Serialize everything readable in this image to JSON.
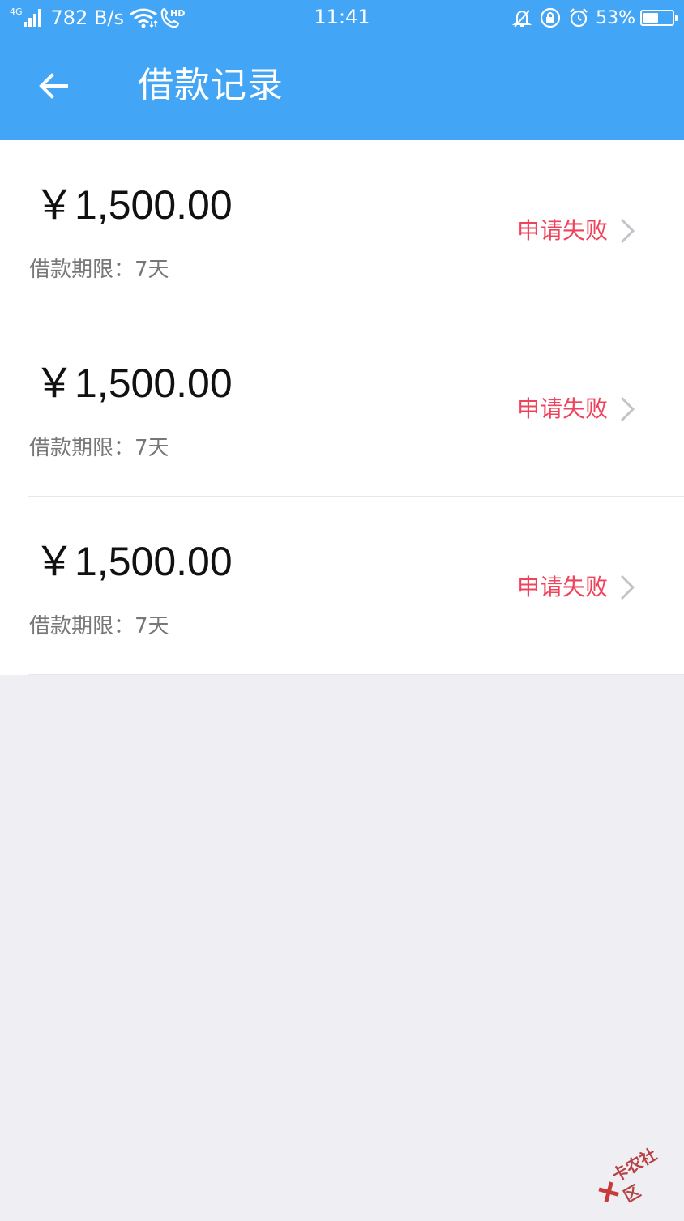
{
  "status_bar": {
    "network": "4G",
    "speed": "782 B/s",
    "hd": "HD",
    "time": "11:41",
    "battery": "53%",
    "battery_level": 0.53
  },
  "header": {
    "title": "借款记录"
  },
  "records": [
    {
      "amount": "￥1,500.00",
      "term": "借款期限：7天",
      "status": "申请失败"
    },
    {
      "amount": "￥1,500.00",
      "term": "借款期限：7天",
      "status": "申请失败"
    },
    {
      "amount": "￥1,500.00",
      "term": "借款期限：7天",
      "status": "申请失败"
    }
  ],
  "watermark": {
    "text": "卡农社区"
  },
  "colors": {
    "primary": "#42a5f5",
    "status_failed": "#f0425a",
    "background": "#eeeef3"
  }
}
